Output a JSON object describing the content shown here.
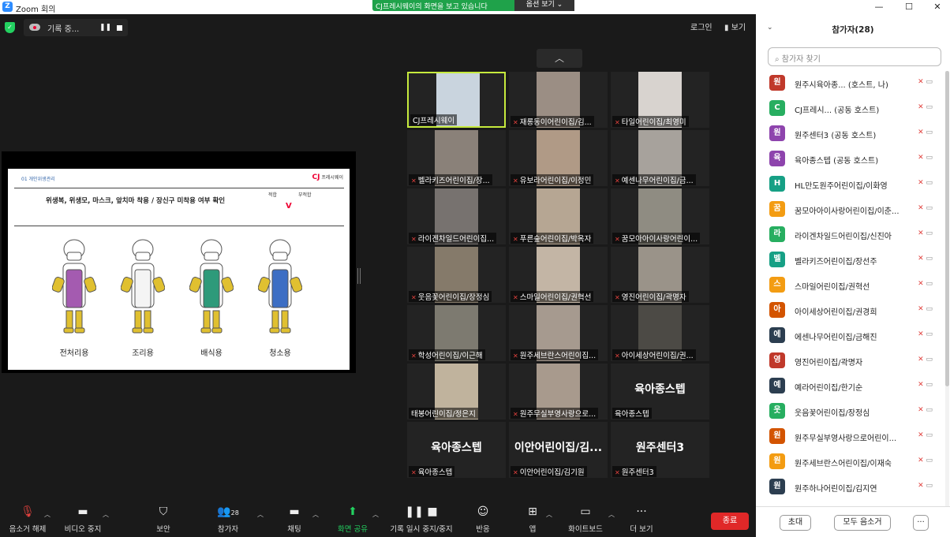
{
  "window": {
    "title": "Zoom 회의",
    "minimize": "—",
    "maximize": "☐",
    "close": "✕"
  },
  "share_banner": {
    "text": "CJ프레시웨이의 화면을 보고 있습니다",
    "options": "옵션 보기 ⌄"
  },
  "recording": {
    "label": "기록 중...",
    "pause": "❚❚"
  },
  "top_right": {
    "login": "로그인",
    "view": "보기"
  },
  "slide": {
    "header": "01 개인위생관리",
    "brand_logo": "CJ",
    "brand_name": "프레시웨이",
    "question": "위생복, 위생모, 마스크, 앞치마 착용 / 장신구 미착용 여부 확인",
    "col_ok": "적합",
    "col_bad": "부적합",
    "check": "V",
    "figures": [
      {
        "label": "전처리용",
        "apron": "#a45bb0"
      },
      {
        "label": "조리용",
        "apron": "#f4f4f4"
      },
      {
        "label": "배식용",
        "apron": "#2e9a7a"
      },
      {
        "label": "청소용",
        "apron": "#3d6ec4"
      }
    ]
  },
  "gallery": {
    "up_arrow": "︿",
    "tiles": [
      {
        "name": "CJ프레시웨이",
        "muted": false,
        "video": "#c9d4de",
        "active": true
      },
      {
        "name": "재롱동이어린이집/김...",
        "muted": true,
        "video": "#9b8e84"
      },
      {
        "name": "타일어린이집/최영미",
        "muted": true,
        "video": "#d8d3cf"
      },
      {
        "name": "벨라키즈어린이집/장...",
        "muted": true,
        "video": "#8a8179"
      },
      {
        "name": "유보라어린이집/이정민",
        "muted": true,
        "video": "#b09a86"
      },
      {
        "name": "예센나무어린이집/금...",
        "muted": true,
        "video": "#a7a29c"
      },
      {
        "name": "라이겐차일드어린이집...",
        "muted": true,
        "video": "#77726f"
      },
      {
        "name": "푸른숲어린이집/박옥자",
        "muted": true,
        "video": "#b6a693"
      },
      {
        "name": "꿈모아아이사랑어린이...",
        "muted": true,
        "video": "#8f8c82"
      },
      {
        "name": "웃음꽃어린이집/장정심",
        "muted": true,
        "video": "#857a6a"
      },
      {
        "name": "스마일어린이집/권혁선",
        "muted": true,
        "video": "#c3b5a5"
      },
      {
        "name": "영진어린이집/곽명자",
        "muted": true,
        "video": "#9a9389"
      },
      {
        "name": "학성어린이집/이근해",
        "muted": true,
        "video": "#7d7a70"
      },
      {
        "name": "원주세브란스어린이집...",
        "muted": true,
        "video": "#a69a8f"
      },
      {
        "name": "아이세상어린이집/권...",
        "muted": true,
        "video": "#4c4a45"
      },
      {
        "name": "태봉어린이집/정은지",
        "muted": false,
        "video": "#c0b39d"
      },
      {
        "name": "원주무실부영사랑으로...",
        "muted": true,
        "video": "#a89a8d"
      },
      {
        "name": "육아종스텝",
        "muted": false,
        "big": "육아종스텝"
      },
      {
        "name": "육아종스텝",
        "muted": true,
        "big": "육아종스텝"
      },
      {
        "name": "이안어린이집/김기원",
        "muted": true,
        "big": "이안어린이집/김..."
      },
      {
        "name": "원주센터3",
        "muted": true,
        "big": "원주센터3"
      }
    ]
  },
  "toolbar": {
    "unmute": "음소거 해제",
    "video_stop": "비디오 중지",
    "security": "보안",
    "participants": "참가자",
    "participants_count": "28",
    "chat": "채팅",
    "share": "화면 공유",
    "pause_record": "기록 일시 중지/중지",
    "reactions": "반응",
    "apps": "앱",
    "whiteboard": "화이트보드",
    "more": "더 보기",
    "end": "종료"
  },
  "panel": {
    "title": "참가자(28)",
    "search_placeholder": "참가자 찾기",
    "participants": [
      {
        "initial": "원",
        "color": "#c0392b",
        "name": "원주시육아종... (호스트, 나)"
      },
      {
        "initial": "C",
        "color": "#27ae60",
        "name": "CJ프레시... (공동 호스트)"
      },
      {
        "initial": "원",
        "color": "#8e44ad",
        "name": "원주센터3 (공동 호스트)"
      },
      {
        "initial": "육",
        "color": "#8e44ad",
        "name": "육아종스텝 (공동 호스트)"
      },
      {
        "initial": "H",
        "color": "#16a085",
        "name": "HL만도원주어린이집/이화영"
      },
      {
        "initial": "꿈",
        "color": "#f39c12",
        "name": "꿈모아아이사랑어린이집/이춘..."
      },
      {
        "initial": "라",
        "color": "#27ae60",
        "name": "라이겐차일드어린이집/신진아"
      },
      {
        "initial": "벨",
        "color": "#16a085",
        "name": "벨라키즈어린이집/장선주"
      },
      {
        "initial": "스",
        "color": "#f39c12",
        "name": "스마일어린이집/권혁선"
      },
      {
        "initial": "아",
        "color": "#d35400",
        "name": "아이세상어린이집/권경희"
      },
      {
        "initial": "에",
        "color": "#2c3e50",
        "name": "에센나무어린이집/금해진"
      },
      {
        "initial": "영",
        "color": "#c0392b",
        "name": "영진어린이집/곽명자"
      },
      {
        "initial": "예",
        "color": "#2c3e50",
        "name": "예라어린이집/한기순"
      },
      {
        "initial": "웃",
        "color": "#27ae60",
        "name": "웃음꽃어린이집/장정심"
      },
      {
        "initial": "원",
        "color": "#d35400",
        "name": "원주무실부영사랑으로어린이..."
      },
      {
        "initial": "원",
        "color": "#f39c12",
        "name": "원주세브란스어린이집/이재숙"
      },
      {
        "initial": "원",
        "color": "#2c3e50",
        "name": "원주하나어린이집/김지연"
      }
    ],
    "invite": "초대",
    "mute_all": "모두 음소거",
    "more": "···"
  }
}
